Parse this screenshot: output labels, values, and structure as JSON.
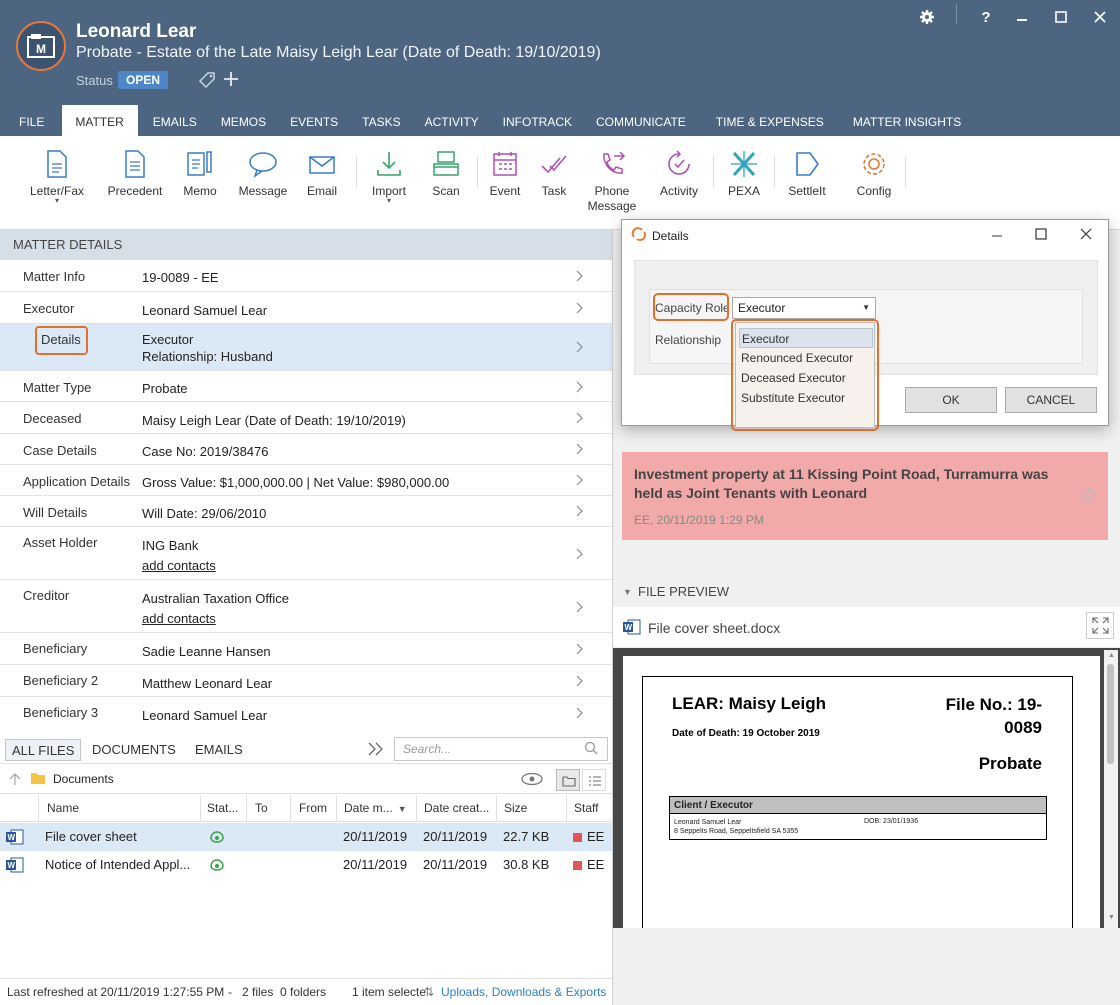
{
  "header": {
    "title": "Leonard Lear",
    "subtitle": "Probate - Estate of the Late Maisy Leigh Lear (Date of Death: 19/10/2019)",
    "status_label": "Status",
    "status_value": "OPEN"
  },
  "tabs": [
    "FILE",
    "MATTER",
    "EMAILS",
    "MEMOS",
    "EVENTS",
    "TASKS",
    "ACTIVITY",
    "INFOTRACK",
    "COMMUNICATE",
    "TIME & EXPENSES",
    "MATTER INSIGHTS"
  ],
  "ribbon": {
    "letter_fax": "Letter/Fax",
    "precedent": "Precedent",
    "memo": "Memo",
    "message": "Message",
    "email": "Email",
    "import": "Import",
    "scan": "Scan",
    "event": "Event",
    "task": "Task",
    "phone_message_1": "Phone",
    "phone_message_2": "Message",
    "activity": "Activity",
    "pexa": "PEXA",
    "settleit": "SettleIt",
    "config": "Config"
  },
  "matter_details": {
    "header": "MATTER DETAILS",
    "rows": [
      {
        "label": "Matter Info",
        "value": "19-0089 - EE"
      },
      {
        "label": "Executor",
        "value": "Leonard Samuel Lear"
      },
      {
        "label": "Details",
        "value": "Executor",
        "value2": "Relationship: Husband"
      },
      {
        "label": "Matter Type",
        "value": "Probate"
      },
      {
        "label": "Deceased",
        "value": "Maisy Leigh Lear (Date of Death: 19/10/2019)"
      },
      {
        "label": "Case Details",
        "value": "Case No: 2019/38476"
      },
      {
        "label": "Application Details",
        "value": "Gross Value: $1,000,000.00 | Net Value: $980,000.00"
      },
      {
        "label": "Will Details",
        "value": "Will Date: 29/06/2010"
      },
      {
        "label": "Asset Holder",
        "value": "ING Bank",
        "link": "add contacts"
      },
      {
        "label": "Creditor",
        "value": "Australian Taxation Office",
        "link": "add contacts"
      },
      {
        "label": "Beneficiary",
        "value": "Sadie Leanne Hansen"
      },
      {
        "label": "Beneficiary 2",
        "value": "Matthew Leonard Lear"
      },
      {
        "label": "Beneficiary 3",
        "value": "Leonard Samuel Lear"
      }
    ]
  },
  "files": {
    "tabs": [
      "ALL FILES",
      "DOCUMENTS",
      "EMAILS"
    ],
    "search_placeholder": "Search...",
    "folder": "Documents",
    "columns": [
      "Name",
      "Stat...",
      "To",
      "From",
      "Date m...",
      "Date creat...",
      "Size",
      "Staff"
    ],
    "rows": [
      {
        "name": "File cover sheet",
        "modified": "20/11/2019",
        "created": "20/11/2019",
        "size": "22.7 KB",
        "staff": "EE"
      },
      {
        "name": "Notice of Intended Appl...",
        "modified": "20/11/2019",
        "created": "20/11/2019",
        "size": "30.8 KB",
        "staff": "EE"
      }
    ]
  },
  "statusbar": {
    "refreshed": "Last refreshed at 20/11/2019 1:27:55 PM",
    "counts": "-   2 files  0 folders",
    "selected": "1 item selecte",
    "uploads": "Uploads, Downloads & Exports"
  },
  "memo": {
    "text": "Investment property at 11 Kissing Point Road, Turramurra was held as Joint Tenants with Leonard",
    "meta": "EE, 20/11/2019 1:29 PM"
  },
  "file_preview": {
    "header": "FILE PREVIEW",
    "filename": "File cover sheet.docx",
    "doc": {
      "name": "LEAR: Maisy Leigh",
      "dod": "Date of Death: 19 October 2019",
      "file_no_1": "File No.: 19-",
      "file_no_2": "0089",
      "type": "Probate",
      "table_header": "Client / Executor",
      "client_name": "Leonard Samuel Lear",
      "client_address": "8 Seppelts Road, Seppeltsfield SA 5355",
      "dob": "DOB: 23/01/1936"
    }
  },
  "dialog": {
    "title": "Details",
    "capacity_label": "Capacity Role",
    "relationship_label": "Relationship",
    "selected": "Executor",
    "options": [
      "Executor",
      "Renounced Executor",
      "Deceased Executor",
      "Substitute Executor"
    ],
    "ok": "OK",
    "cancel": "CANCEL"
  },
  "colors": {
    "header_bg": "#4d6580",
    "accent_orange": "#e0702e",
    "status_badge": "#4f86c6",
    "memo_bg": "#f2a9a9",
    "selected_row": "#dbe9f7"
  }
}
